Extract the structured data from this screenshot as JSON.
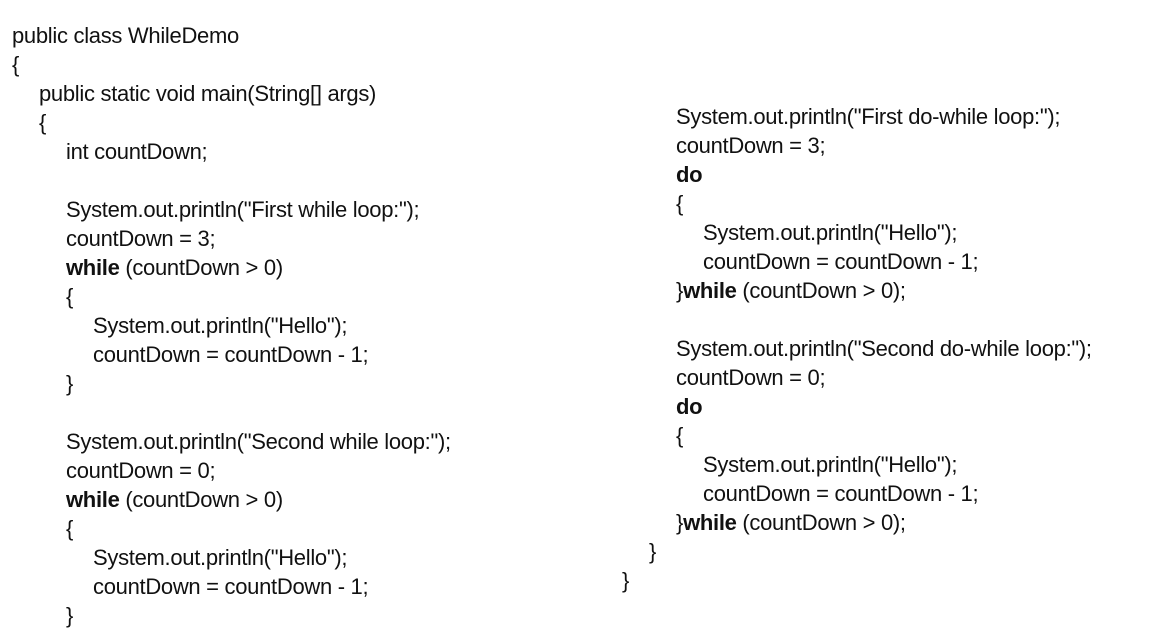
{
  "code": {
    "left_column": [
      {
        "text": "public class WhileDemo",
        "keyword": ""
      },
      {
        "text": "{",
        "keyword": ""
      },
      {
        "text": "public static void main(String[] args)",
        "keyword": ""
      },
      {
        "text": "{",
        "keyword": ""
      },
      {
        "text": "int countDown;",
        "keyword": ""
      },
      {
        "text": "System.out.println(\"First while loop:\");",
        "keyword": ""
      },
      {
        "text": "countDown = 3;",
        "keyword": ""
      },
      {
        "text": " (countDown > 0)",
        "keyword": "while"
      },
      {
        "text": "{",
        "keyword": ""
      },
      {
        "text": "System.out.println(\"Hello\");",
        "keyword": ""
      },
      {
        "text": "countDown = countDown - 1;",
        "keyword": ""
      },
      {
        "text": "}",
        "keyword": ""
      },
      {
        "text": "System.out.println(\"Second while loop:\");",
        "keyword": ""
      },
      {
        "text": "countDown = 0;",
        "keyword": ""
      },
      {
        "text": " (countDown > 0)",
        "keyword": "while"
      },
      {
        "text": "{",
        "keyword": ""
      },
      {
        "text": "System.out.println(\"Hello\");",
        "keyword": ""
      },
      {
        "text": "countDown = countDown - 1;",
        "keyword": ""
      },
      {
        "text": "}",
        "keyword": ""
      }
    ],
    "right_column": [
      {
        "text": "System.out.println(\"First do-while loop:\");",
        "keyword": "",
        "prefix": ""
      },
      {
        "text": "countDown = 3;",
        "keyword": "",
        "prefix": ""
      },
      {
        "text": "",
        "keyword": "do",
        "prefix": ""
      },
      {
        "text": "{",
        "keyword": "",
        "prefix": ""
      },
      {
        "text": "System.out.println(\"Hello\");",
        "keyword": "",
        "prefix": ""
      },
      {
        "text": "countDown = countDown - 1;",
        "keyword": "",
        "prefix": ""
      },
      {
        "text": " (countDown > 0);",
        "keyword": "while",
        "prefix": "}"
      },
      {
        "text": "System.out.println(\"Second do-while loop:\");",
        "keyword": "",
        "prefix": ""
      },
      {
        "text": "countDown = 0;",
        "keyword": "",
        "prefix": ""
      },
      {
        "text": "",
        "keyword": "do",
        "prefix": ""
      },
      {
        "text": "{",
        "keyword": "",
        "prefix": ""
      },
      {
        "text": "System.out.println(\"Hello\");",
        "keyword": "",
        "prefix": ""
      },
      {
        "text": "countDown = countDown - 1;",
        "keyword": "",
        "prefix": ""
      },
      {
        "text": " (countDown > 0);",
        "keyword": "while",
        "prefix": "}"
      },
      {
        "text": "}",
        "keyword": "",
        "prefix": ""
      },
      {
        "text": "}",
        "keyword": "",
        "prefix": ""
      }
    ]
  }
}
